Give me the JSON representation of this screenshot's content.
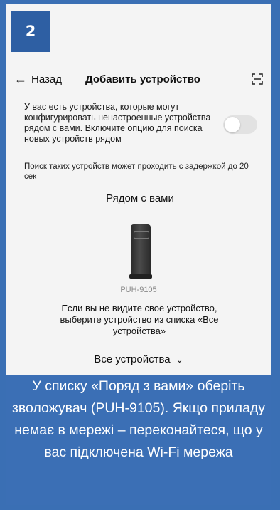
{
  "step_badge": "2",
  "header": {
    "back_label": "Назад",
    "title": "Добавить устройство"
  },
  "description": "У вас есть устройства, которые могут конфигурировать ненастроенные устройства рядом с вами. Включите опцию для поиска новых устройств рядом",
  "toggle": {
    "state": "off"
  },
  "note": "Поиск таких устройств может проходить с задержкой до 20 сек",
  "nearby": {
    "title": "Рядом с вами",
    "device_name": "PUH-9105"
  },
  "hint": "Если вы не видите свое устройство, выберите устройство из списка «Все устройства»",
  "all_devices_label": "Все устройства",
  "caption": "У списку «Поряд з вами» оберіть зволожувач (PUH-9105). Якщо приладу немає в мережі – переконайтеся, що у вас підключена Wi-Fi мережа",
  "colors": {
    "caption_bg": "#3b6fb5",
    "badge_bg": "#2e5fa3",
    "toggle_off": "#e2e2e2"
  },
  "icons": [
    "back-arrow-icon",
    "scan-icon",
    "chevron-down-icon"
  ]
}
